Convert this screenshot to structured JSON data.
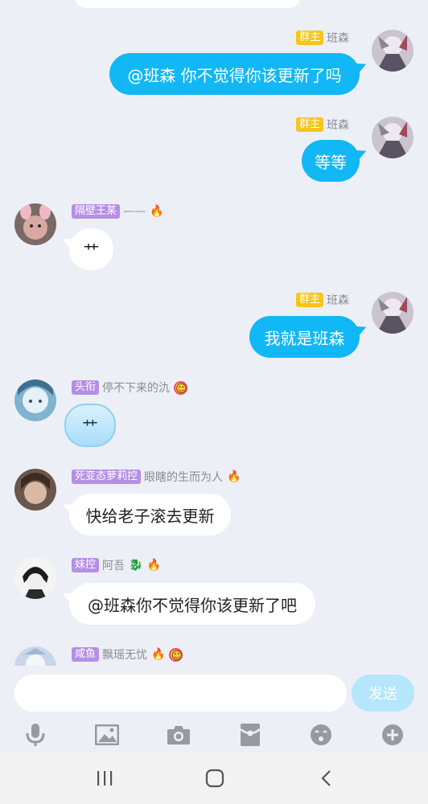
{
  "messages": [
    {
      "side": "me",
      "badge": "群主",
      "name": "班森",
      "text": "@班森 你不觉得你该更新了吗"
    },
    {
      "side": "me",
      "badge": "群主",
      "name": "班森",
      "text": "等等"
    },
    {
      "side": "other",
      "badge": "隔壁王某",
      "name": "——",
      "text": "艹"
    },
    {
      "side": "me",
      "badge": "群主",
      "name": "班森",
      "text": "我就是班森"
    },
    {
      "side": "other",
      "badge": "头衔",
      "name": "停不下来的氿",
      "text": "艹"
    },
    {
      "side": "other",
      "badge": "死变态萝莉控",
      "name": "眼瞎的生而为人",
      "text": "快给老子滚去更新"
    },
    {
      "side": "other",
      "badge": "妹控",
      "name": "阿吾",
      "text": "@班森你不觉得你该更新了吧"
    },
    {
      "side": "other",
      "badge": "咸鱼",
      "name": "飘瑶无忧",
      "text": ""
    }
  ],
  "composer": {
    "placeholder": "",
    "send_label": "发送"
  },
  "toolbar": {
    "icons": [
      "microphone-icon",
      "image-icon",
      "camera-icon",
      "red-packet-icon",
      "emoji-icon",
      "plus-icon"
    ]
  },
  "navbar": {
    "icons": [
      "recent-apps-icon",
      "home-icon",
      "back-icon"
    ]
  },
  "colors": {
    "background": "#edeff6",
    "my_bubble": "#12b7f5",
    "other_bubble": "#ffffff",
    "owner_badge": "#f7c51a",
    "title_badge": "#b58ee6",
    "send_button": "#b5e6fa"
  }
}
